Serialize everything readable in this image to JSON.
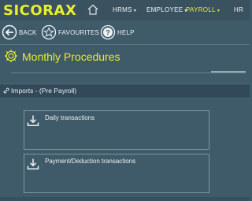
{
  "header": {
    "brand": "SICORAX",
    "nav": [
      {
        "label": "HRMS"
      },
      {
        "label": "EMPLOYEE"
      },
      {
        "label": "PAYROLL"
      },
      {
        "label": "HR"
      }
    ],
    "caret": "▾"
  },
  "actions": {
    "back": "BACK",
    "favourites": "FAVOURITES",
    "help": "HELP"
  },
  "page": {
    "title": "Monthly Procedures"
  },
  "section": {
    "title": "Imports - (Pre Payroll)"
  },
  "cards": [
    {
      "label": "Daily transactions",
      "icon": "download-icon"
    },
    {
      "label": "Payment/Deduction transactions",
      "icon": "download-icon"
    }
  ],
  "colors": {
    "accent": "#e8ef2a",
    "background": "#3f5a69"
  }
}
